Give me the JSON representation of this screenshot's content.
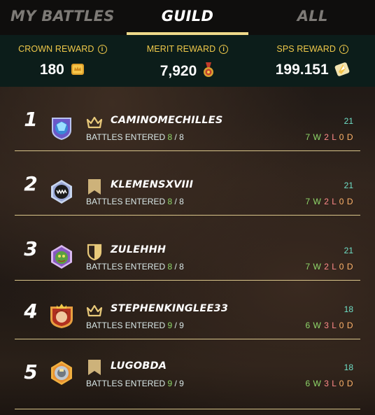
{
  "tabs": [
    {
      "label": "MY BATTLES",
      "active": false
    },
    {
      "label": "GUILD",
      "active": true
    },
    {
      "label": "ALL",
      "active": false
    }
  ],
  "rewards": {
    "crown": {
      "label": "CROWN REWARD",
      "value": "180",
      "icon": "crown-token-icon"
    },
    "merit": {
      "label": "MERIT REWARD",
      "value": "7,920",
      "icon": "merit-medal-icon"
    },
    "sps": {
      "label": "SPS REWARD",
      "value": "199.151",
      "icon": "sps-crystal-icon"
    }
  },
  "players": [
    {
      "rank": "1",
      "name": "CAMINOMECHILLES",
      "role_icon": "crown-icon",
      "battles_done": "8",
      "battles_total": "/ 8",
      "score": "21",
      "wins": "7",
      "losses": "2",
      "draws": "0"
    },
    {
      "rank": "2",
      "name": "KLEMENSXVIII",
      "role_icon": "banner-icon",
      "battles_done": "8",
      "battles_total": "/ 8",
      "score": "21",
      "wins": "7",
      "losses": "2",
      "draws": "0"
    },
    {
      "rank": "3",
      "name": "ZULEHHH",
      "role_icon": "shield-icon",
      "battles_done": "8",
      "battles_total": "/ 8",
      "score": "21",
      "wins": "7",
      "losses": "2",
      "draws": "0"
    },
    {
      "rank": "4",
      "name": "STEPHENKINGLEE33",
      "role_icon": "crown-icon",
      "battles_done": "9",
      "battles_total": "/ 9",
      "score": "18",
      "wins": "6",
      "losses": "3",
      "draws": "0"
    },
    {
      "rank": "5",
      "name": "LUGOBDA",
      "role_icon": "banner-icon",
      "battles_done": "9",
      "battles_total": "/ 9",
      "score": "18",
      "wins": "6",
      "losses": "3",
      "draws": "0"
    }
  ],
  "labels": {
    "battles_entered": "BATTLES ENTERED",
    "w": "W",
    "l": "L",
    "d": "D"
  },
  "colors": {
    "gold": "#f0c94a",
    "tab_underline": "#eed98a",
    "win": "#8fd86a",
    "loss": "#ff8a8a",
    "draw": "#ffb36a",
    "score": "#6fe0c8"
  }
}
